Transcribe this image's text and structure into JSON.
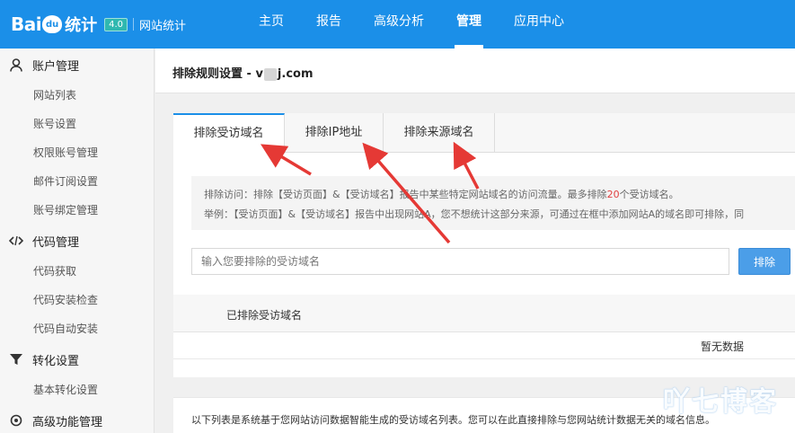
{
  "header": {
    "logo_bai": "Bai",
    "logo_du": "du",
    "logo_tongji": "统计",
    "logo_version": "4.0",
    "logo_subtitle": "网站统计",
    "nav": [
      "主页",
      "报告",
      "高级分析",
      "管理",
      "应用中心"
    ],
    "active_nav": "管理"
  },
  "sidebar": {
    "groups": [
      {
        "label": "账户管理",
        "icon": "user-icon",
        "items": [
          "网站列表",
          "账号设置",
          "权限账号管理",
          "邮件订阅设置",
          "账号绑定管理"
        ]
      },
      {
        "label": "代码管理",
        "icon": "code-icon",
        "items": [
          "代码获取",
          "代码安装检查",
          "代码自动安装"
        ]
      },
      {
        "label": "转化设置",
        "icon": "filter-icon",
        "items": [
          "基本转化设置"
        ]
      },
      {
        "label": "高级功能管理",
        "icon": "settings-icon",
        "items": []
      }
    ]
  },
  "page": {
    "title_prefix": "排除规则设置 - v",
    "title_suffix": "j.com"
  },
  "tabs": [
    "排除受访域名",
    "排除IP地址",
    "排除来源域名"
  ],
  "notice": {
    "line1_a": "排除访问：排除【受访页面】&【受访域名】报告中某些特定网站域名的访问流量。最多排除",
    "line1_num": "20",
    "line1_b": "个受访域名。",
    "line2": "举例：【受访页面】&【受访域名】报告中出现网站A，您不想统计这部分来源，可通过在框中添加网站A的域名即可排除，同"
  },
  "form": {
    "placeholder": "输入您要排除的受访域名",
    "button": "排除"
  },
  "table": {
    "header": "已排除受访域名",
    "empty": "暂无数据"
  },
  "footer_text": "以下列表是系统基于您网站访问数据智能生成的受访域名列表。您可以在此直接排除与您网站统计数据无关的域名信息。",
  "watermark": "吖七博客",
  "colors": {
    "brand": "#1b8fe8",
    "button": "#4b9ee8",
    "highlight": "#e04040",
    "arrow": "#e53935"
  }
}
